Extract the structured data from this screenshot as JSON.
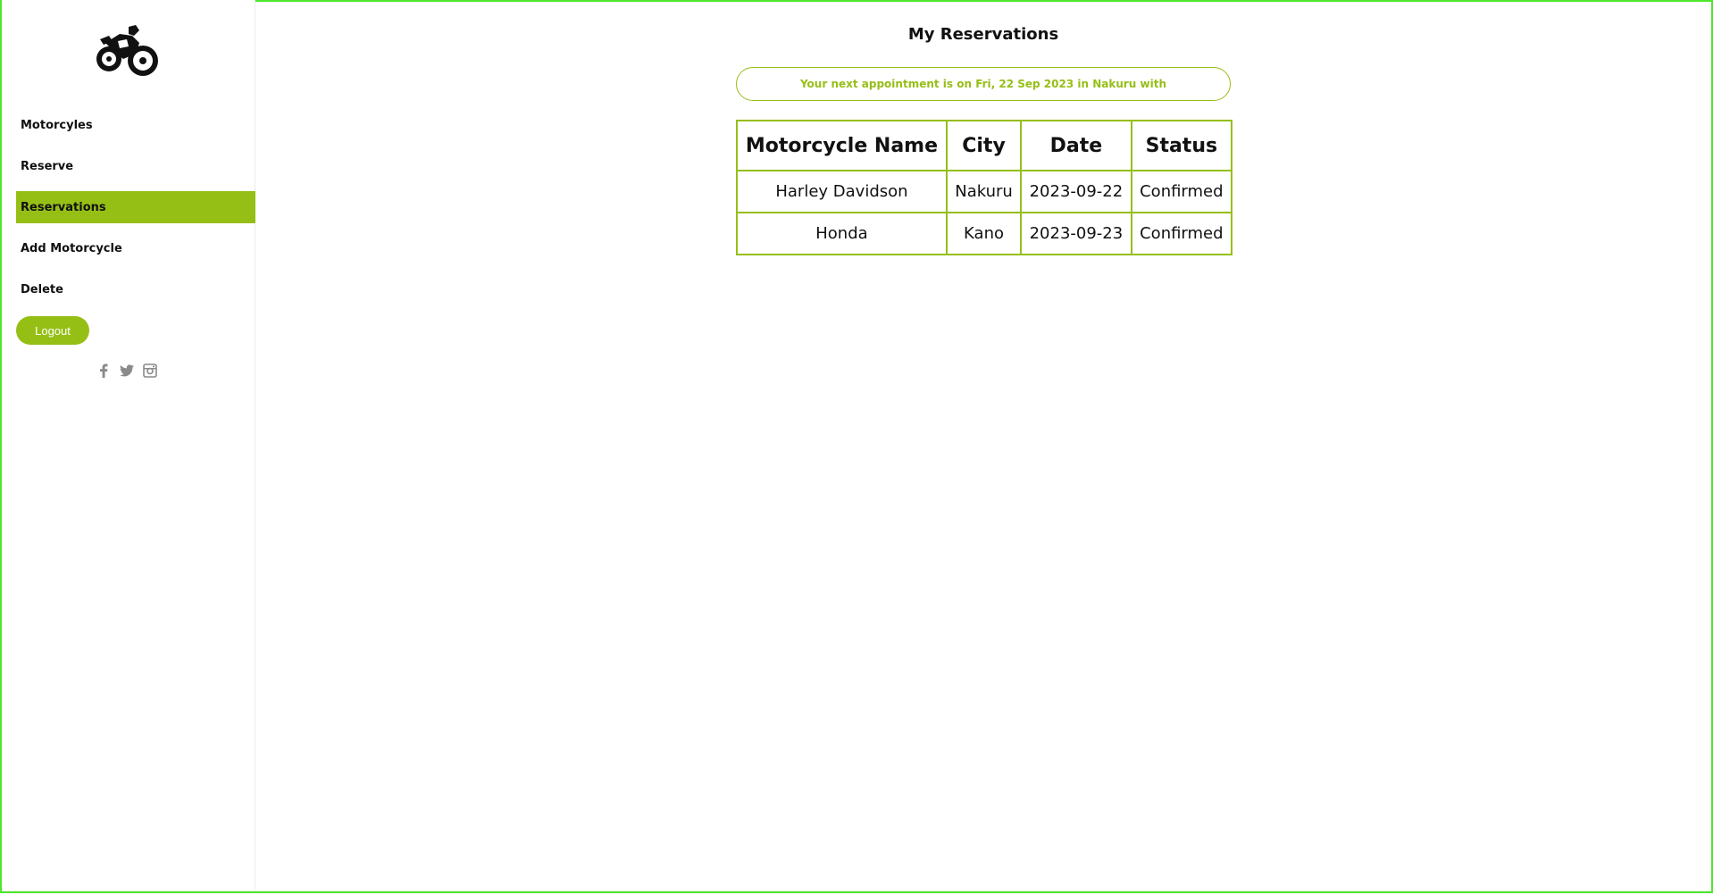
{
  "sidebar": {
    "logo_icon": "motorcycle-logo-icon",
    "items": [
      {
        "label": "Motorcyles",
        "active": false
      },
      {
        "label": "Reserve",
        "active": false
      },
      {
        "label": "Reservations",
        "active": true
      },
      {
        "label": "Add Motorcycle",
        "active": false
      },
      {
        "label": "Delete",
        "active": false
      }
    ],
    "logout_label": "Logout",
    "socials": [
      "facebook-icon",
      "twitter-icon",
      "instagram-icon"
    ]
  },
  "main": {
    "title": "My Reservations",
    "banner": "Your next appointment is on Fri, 22 Sep 2023 in Nakuru with",
    "table": {
      "headers": [
        "Motorcycle Name",
        "City",
        "Date",
        "Status"
      ],
      "rows": [
        [
          "Harley Davidson",
          "Nakuru",
          "2023-09-22",
          "Confirmed"
        ],
        [
          "Honda",
          "Kano",
          "2023-09-23",
          "Confirmed"
        ]
      ]
    }
  },
  "colors": {
    "accent": "#96bf16",
    "frame_border": "#4ce62b",
    "text": "#111111"
  }
}
